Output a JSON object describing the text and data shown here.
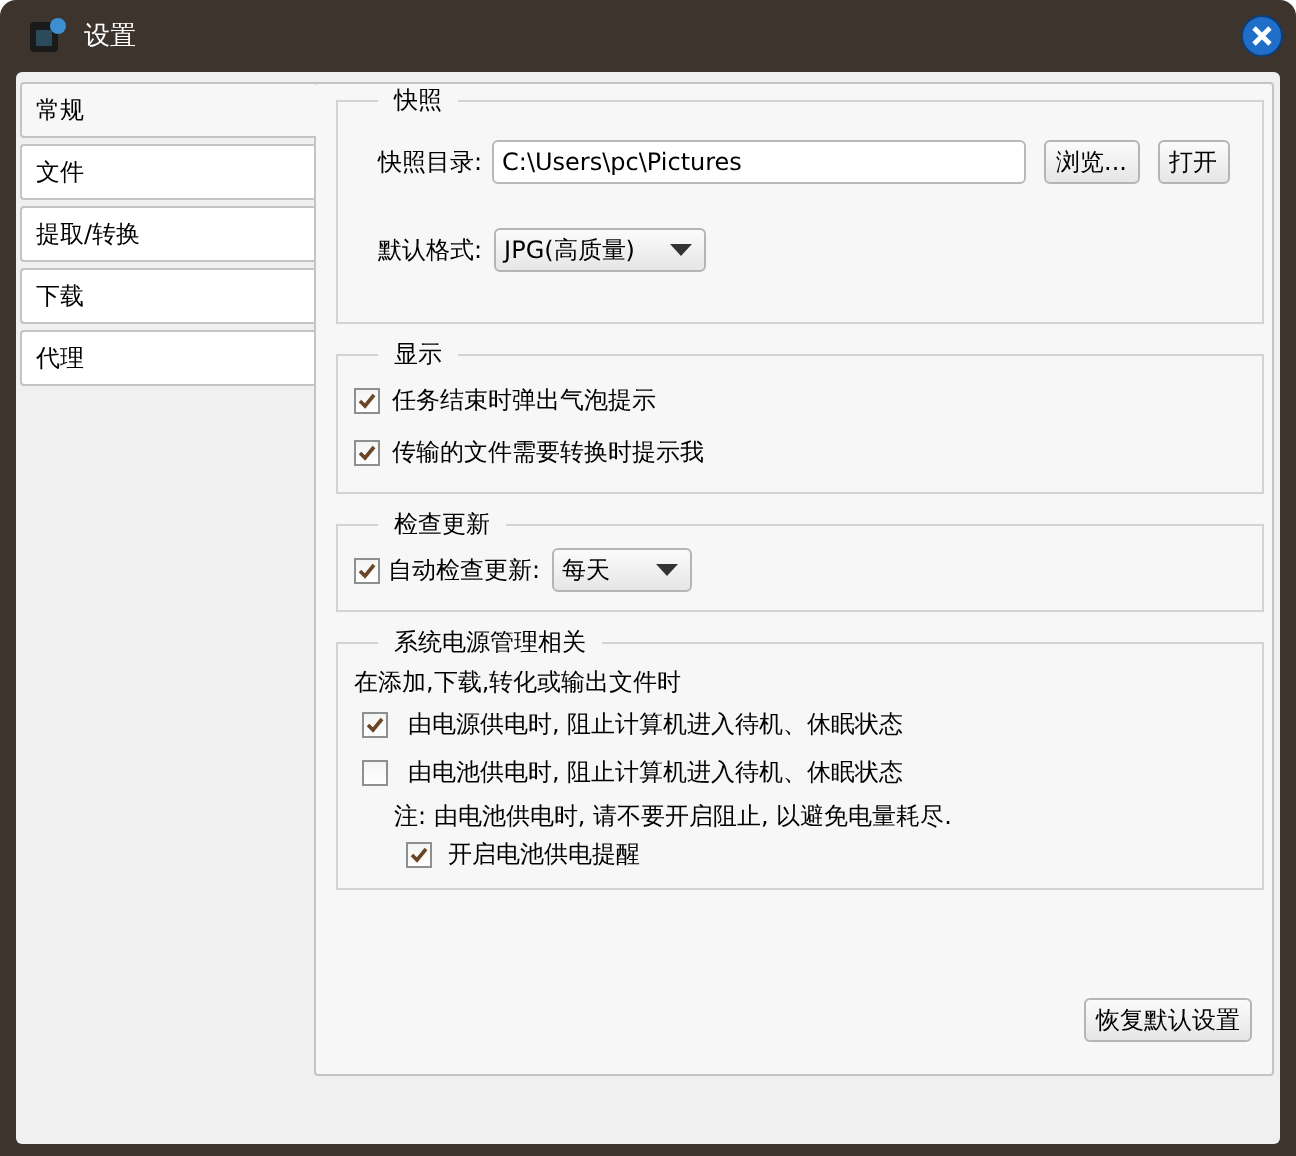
{
  "window": {
    "title": "设置"
  },
  "tabs": [
    {
      "label": "常规",
      "selected": true
    },
    {
      "label": "文件",
      "selected": false
    },
    {
      "label": "提取/转换",
      "selected": false
    },
    {
      "label": "下载",
      "selected": false
    },
    {
      "label": "代理",
      "selected": false
    }
  ],
  "sections": [
    {
      "title": "快照",
      "rows": [
        {
          "kind": "path",
          "label": "快照目录:",
          "value": "C:\\Users\\pc\\Pictures",
          "buttons": [
            "浏览...",
            "打开"
          ]
        },
        {
          "kind": "select",
          "label": "默认格式:",
          "value": "JPG(高质量)"
        }
      ]
    },
    {
      "title": "显示",
      "rows": [
        {
          "kind": "checkbox",
          "label": "任务结束时弹出气泡提示",
          "checked": true
        },
        {
          "kind": "checkbox",
          "label": "传输的文件需要转换时提示我",
          "checked": true
        }
      ]
    },
    {
      "title": "检查更新",
      "rows": [
        {
          "kind": "checkbox-select",
          "label": "自动检查更新:",
          "checked": true,
          "value": "每天"
        }
      ]
    },
    {
      "title": "系统电源管理相关",
      "rows": [
        {
          "kind": "text",
          "label": "在添加,下载,转化或输出文件时"
        },
        {
          "kind": "checkbox",
          "label": "由电源供电时, 阻止计算机进入待机、休眠状态",
          "checked": true
        },
        {
          "kind": "checkbox",
          "label": "由电池供电时, 阻止计算机进入待机、休眠状态",
          "checked": false
        },
        {
          "kind": "note",
          "label": "注: 由电池供电时, 请不要开启阻止, 以避免电量耗尽."
        },
        {
          "kind": "sub-checkbox",
          "label": "开启电池供电提醒",
          "checked": true
        }
      ]
    }
  ],
  "reset_button": "恢复默认设置"
}
